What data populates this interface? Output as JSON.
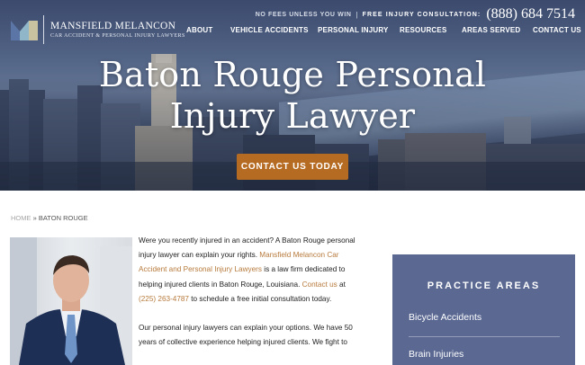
{
  "brand": {
    "name": "MANSFIELD MELANCON",
    "tagline": "CAR ACCIDENT & PERSONAL INJURY LAWYERS"
  },
  "topbar": {
    "no_fees": "NO FEES UNLESS YOU WIN",
    "separator": "|",
    "free_consult": "FREE INJURY CONSULTATION:",
    "phone": "(888) 684 7514"
  },
  "nav": {
    "items": [
      "ABOUT",
      "VEHICLE ACCIDENTS",
      "PERSONAL INJURY",
      "RESOURCES",
      "AREAS SERVED",
      "CONTACT US"
    ]
  },
  "hero": {
    "title_line1": "Baton Rouge Personal",
    "title_line2": "Injury Lawyer",
    "cta": "CONTACT US TODAY"
  },
  "breadcrumb": {
    "home": "HOME",
    "sep": " » ",
    "current": "BATON ROUGE"
  },
  "article": {
    "p1_a": "Were you recently injured in an accident? A Baton Rouge personal injury lawyer can explain your rights. ",
    "p1_link1": "Mansfield Melancon Car Accident and Personal Injury Lawyers",
    "p1_b": " is a law firm dedicated to helping injured clients in Baton Rouge, Louisiana. ",
    "p1_link2": "Contact us",
    "p1_c": " at ",
    "p1_phone": "(225) 263-4787",
    "p1_d": " to schedule a free initial consultation today.",
    "p2": "Our personal injury lawyers can explain your options. We have 50 years of collective experience helping injured clients. We fight to"
  },
  "sidebar": {
    "heading": "PRACTICE AREAS",
    "items": [
      "Bicycle Accidents",
      "Brain Injuries"
    ]
  },
  "colors": {
    "accent": "#b66b22",
    "link": "#b77a3c",
    "sidebar_bg": "#5a6892"
  }
}
